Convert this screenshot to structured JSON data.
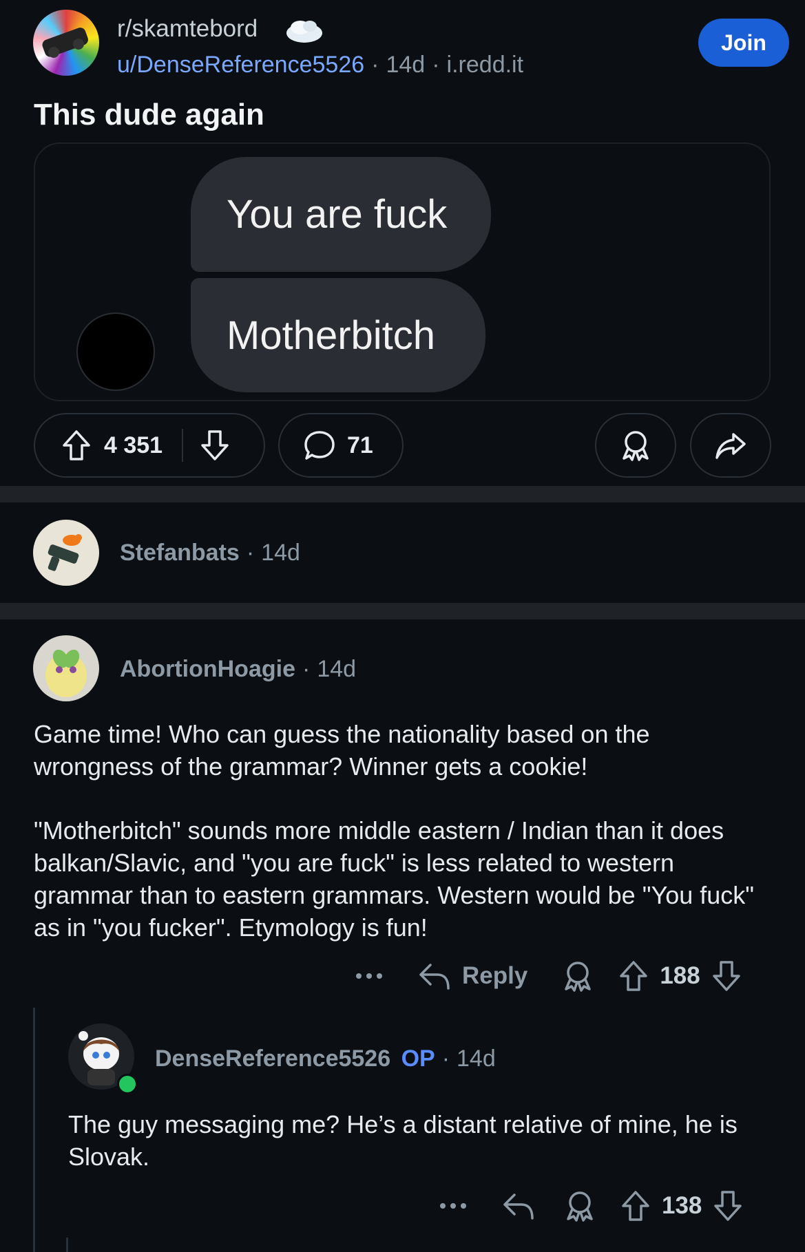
{
  "post": {
    "subreddit": "r/skamtebord",
    "author": "u/DenseReference5526",
    "age": "14d",
    "domain": "i.redd.it",
    "join_label": "Join",
    "title": "This dude again",
    "image_messages": [
      "You are fuck",
      "Motherbitch"
    ],
    "upvotes": "4 351",
    "comments": "71"
  },
  "comments": [
    {
      "author": "Stefanbats",
      "age": "14d"
    },
    {
      "author": "AbortionHoagie",
      "age": "14d",
      "body_p1": "Game time! Who can guess the nationality based on the wrongness of the grammar? Winner gets a cookie!",
      "body_p2": "\"Motherbitch\" sounds more middle eastern / Indian than it does balkan/Slavic, and \"you are fuck\" is less related to western grammar than to eastern grammars. Western would be \"You fuck\" as in \"you fucker\". Etymology is fun!",
      "reply_label": "Reply",
      "score": "188"
    },
    {
      "author": "DenseReference5526",
      "op_badge": "OP",
      "age": "14d",
      "body": "The guy messaging me? He’s a distant relative of mine, he is Slovak.",
      "score": "138"
    }
  ],
  "icons": [
    "subreddit-avatar",
    "upvote-icon",
    "downvote-icon",
    "comment-icon",
    "award-icon",
    "share-icon",
    "more-icon",
    "reply-icon"
  ],
  "colors": {
    "background": "#0b0e12",
    "accent": "#1a5fd6",
    "username": "#7aa8ff",
    "online": "#22c55e"
  }
}
